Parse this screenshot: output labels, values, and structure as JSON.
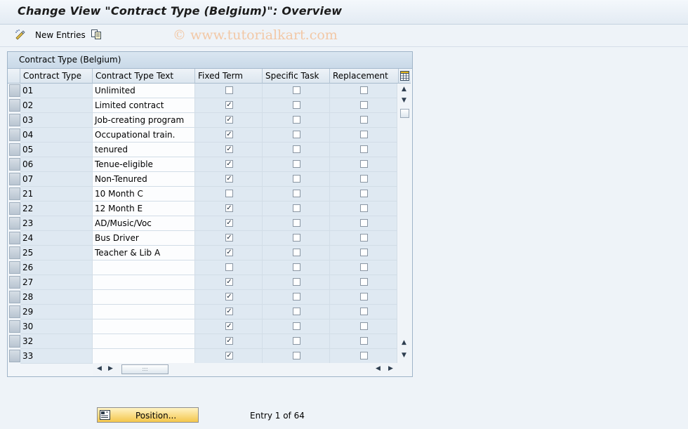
{
  "window": {
    "title": "Change View \"Contract Type (Belgium)\": Overview"
  },
  "toolbar": {
    "new_entries_label": "New Entries",
    "watermark": "© www.tutorialkart.com"
  },
  "table": {
    "title": "Contract Type (Belgium)",
    "columns": [
      "Contract Type",
      "Contract Type Text",
      "Fixed Term",
      "Specific Task",
      "Replacement"
    ],
    "rows": [
      {
        "type": "01",
        "text": "Unlimited",
        "fixed": false,
        "specific": false,
        "replacement": false
      },
      {
        "type": "02",
        "text": "Limited contract",
        "fixed": true,
        "specific": false,
        "replacement": false
      },
      {
        "type": "03",
        "text": "Job-creating program",
        "fixed": true,
        "specific": false,
        "replacement": false
      },
      {
        "type": "04",
        "text": "Occupational train.",
        "fixed": true,
        "specific": false,
        "replacement": false
      },
      {
        "type": "05",
        "text": "tenured",
        "fixed": true,
        "specific": false,
        "replacement": false
      },
      {
        "type": "06",
        "text": "Tenue-eligible",
        "fixed": true,
        "specific": false,
        "replacement": false
      },
      {
        "type": "07",
        "text": "Non-Tenured",
        "fixed": true,
        "specific": false,
        "replacement": false
      },
      {
        "type": "21",
        "text": "10 Month C",
        "fixed": false,
        "specific": false,
        "replacement": false
      },
      {
        "type": "22",
        "text": "12 Month E",
        "fixed": true,
        "specific": false,
        "replacement": false
      },
      {
        "type": "23",
        "text": "AD/Music/Voc",
        "fixed": true,
        "specific": false,
        "replacement": false
      },
      {
        "type": "24",
        "text": "Bus Driver",
        "fixed": true,
        "specific": false,
        "replacement": false
      },
      {
        "type": "25",
        "text": "Teacher & Lib A",
        "fixed": true,
        "specific": false,
        "replacement": false
      },
      {
        "type": "26",
        "text": "",
        "fixed": false,
        "specific": false,
        "replacement": false
      },
      {
        "type": "27",
        "text": "",
        "fixed": true,
        "specific": false,
        "replacement": false
      },
      {
        "type": "28",
        "text": "",
        "fixed": true,
        "specific": false,
        "replacement": false
      },
      {
        "type": "29",
        "text": "",
        "fixed": true,
        "specific": false,
        "replacement": false
      },
      {
        "type": "30",
        "text": "",
        "fixed": true,
        "specific": false,
        "replacement": false
      },
      {
        "type": "32",
        "text": "",
        "fixed": true,
        "specific": false,
        "replacement": false
      },
      {
        "type": "33",
        "text": "",
        "fixed": true,
        "specific": false,
        "replacement": false
      }
    ]
  },
  "footer": {
    "position_label": "Position...",
    "entry_text": "Entry 1 of 64"
  }
}
